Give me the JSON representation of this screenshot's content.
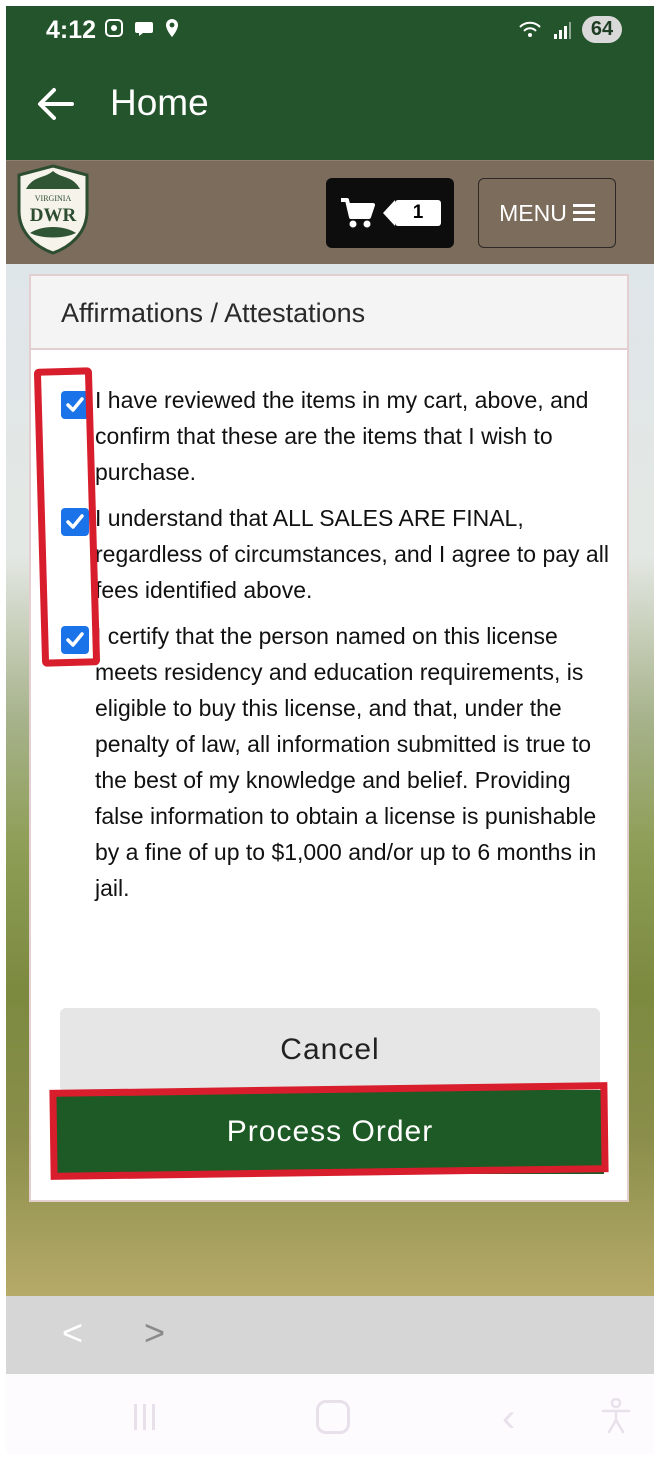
{
  "status_bar": {
    "time": "4:12",
    "battery": "64"
  },
  "app_bar": {
    "title": "Home"
  },
  "site_nav": {
    "cart_count": "1",
    "menu_label": "MENU"
  },
  "card": {
    "title": "Affirmations / Attestations",
    "affirmations": [
      {
        "checked": true,
        "text": "I have reviewed the items in my cart, above, and confirm that these are the items that I wish to purchase."
      },
      {
        "checked": true,
        "text": "I understand that ALL SALES ARE FINAL, regardless of circumstances, and I agree to pay all fees identified above."
      },
      {
        "checked": true,
        "text": "I certify that the person named on this license meets residency and education requirements, is eligible to buy this license, and that, under the penalty of law, all information submitted is true to the best of my knowledge and belief. Providing false information to obtain a license is punishable by a fine of up to $1,000 and/or up to 6 months in jail."
      }
    ],
    "cancel_label": "Cancel",
    "process_label": "Process Order"
  },
  "browser_nav": {
    "prev": "<",
    "next": ">"
  },
  "logo": {
    "line1": "VIRGINIA",
    "line2": "DWR"
  },
  "colors": {
    "header_green": "#24542b",
    "nav_brown": "#7b6c5c",
    "button_green": "#1d5a25",
    "checkbox_blue": "#1a73e8",
    "annotation_red": "#d81e2c"
  }
}
